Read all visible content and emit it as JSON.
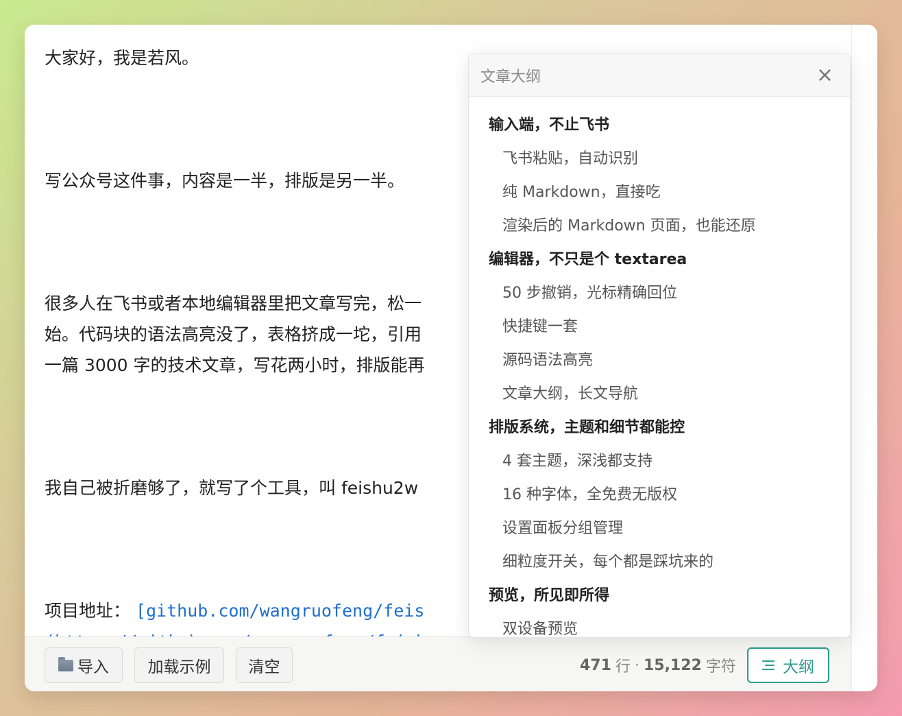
{
  "editor": {
    "lines": [
      "大家好，我是若风。",
      "写公众号这件事，内容是一半，排版是另一半。",
      "很多人在飞书或者本地编辑器里把文章写完，松一",
      "始。代码块的语法高亮没了，表格挤成一坨，引用",
      "一篇 3000 字的技术文章，写花两小时，排版能再",
      "我自己被折磨够了，就写了个工具，叫 feishu2w",
      "项目地址： ",
      "[github.com/wangruofeng/feis",
      "(https://github.com/wangruofeng/feish"
    ]
  },
  "outline": {
    "title": "文章大纲",
    "close_glyph": "×",
    "items": [
      {
        "level": 2,
        "text": "输入端，不止飞书"
      },
      {
        "level": 3,
        "text": "飞书粘贴，自动识别"
      },
      {
        "level": 3,
        "text": "纯 Markdown，直接吃"
      },
      {
        "level": 3,
        "text": "渲染后的 Markdown 页面，也能还原"
      },
      {
        "level": 2,
        "text": "编辑器，不只是个 textarea"
      },
      {
        "level": 3,
        "text": "50 步撤销，光标精确回位"
      },
      {
        "level": 3,
        "text": "快捷键一套"
      },
      {
        "level": 3,
        "text": "源码语法高亮"
      },
      {
        "level": 3,
        "text": "文章大纲，长文导航"
      },
      {
        "level": 2,
        "text": "排版系统，主题和细节都能控"
      },
      {
        "level": 3,
        "text": "4 套主题，深浅都支持"
      },
      {
        "level": 3,
        "text": "16 种字体，全免费无版权"
      },
      {
        "level": 3,
        "text": "设置面板分组管理"
      },
      {
        "level": 3,
        "text": "细粒度开关，每个都是踩坑来的"
      },
      {
        "level": 2,
        "text": "预览，所见即所得"
      },
      {
        "level": 3,
        "text": "双设备预览"
      }
    ]
  },
  "footer": {
    "import_label": "导入",
    "import_icon": "folder-icon",
    "load_example_label": "加载示例",
    "clear_label": "清空",
    "line_count": "471",
    "line_unit": "行",
    "separator": "·",
    "char_count": "15,122",
    "char_unit": "字符",
    "outline_label": "大纲",
    "outline_icon": "outline-list-icon"
  },
  "colors": {
    "accent": "#2a9d8f",
    "link": "#1f6fd0"
  }
}
